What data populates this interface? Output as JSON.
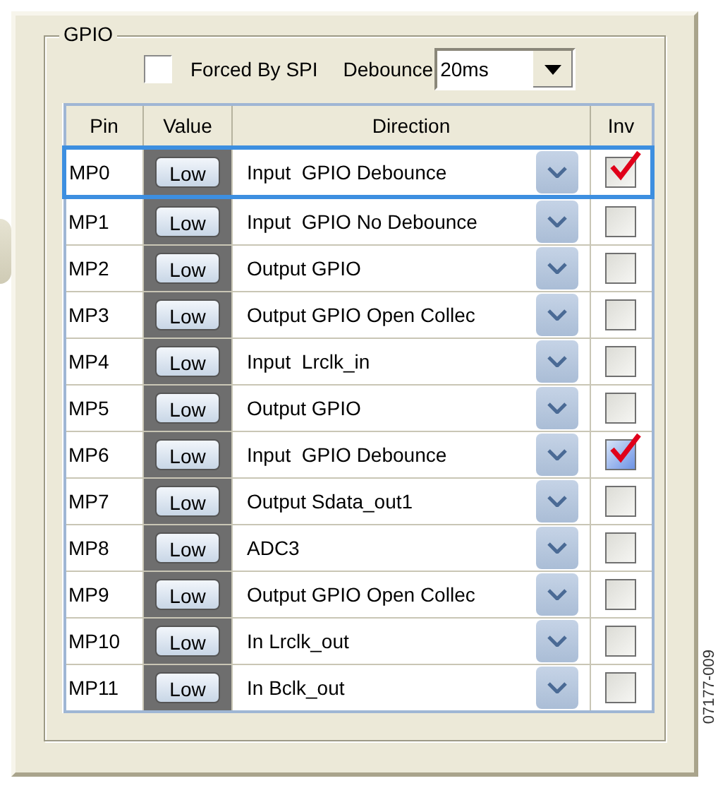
{
  "group": {
    "title": "GPIO"
  },
  "forced_by_spi": {
    "label": "Forced By SPI",
    "checked": false
  },
  "debounce": {
    "label": "Debounce",
    "value": "20ms"
  },
  "table": {
    "columns": [
      "Pin",
      "Value",
      "Direction",
      "Inv"
    ],
    "rows": [
      {
        "pin": "MP0",
        "value": "Low",
        "direction": "Input  GPIO Debounce",
        "inv": true,
        "inv_hover": false,
        "selected": true
      },
      {
        "pin": "MP1",
        "value": "Low",
        "direction": "Input  GPIO No Debounce",
        "inv": false,
        "inv_hover": false,
        "selected": false
      },
      {
        "pin": "MP2",
        "value": "Low",
        "direction": "Output GPIO",
        "inv": false,
        "inv_hover": false,
        "selected": false
      },
      {
        "pin": "MP3",
        "value": "Low",
        "direction": "Output GPIO Open Collec",
        "inv": false,
        "inv_hover": false,
        "selected": false
      },
      {
        "pin": "MP4",
        "value": "Low",
        "direction": "Input  Lrclk_in",
        "inv": false,
        "inv_hover": false,
        "selected": false
      },
      {
        "pin": "MP5",
        "value": "Low",
        "direction": "Output GPIO",
        "inv": false,
        "inv_hover": false,
        "selected": false
      },
      {
        "pin": "MP6",
        "value": "Low",
        "direction": "Input  GPIO Debounce",
        "inv": true,
        "inv_hover": true,
        "selected": false
      },
      {
        "pin": "MP7",
        "value": "Low",
        "direction": "Output Sdata_out1",
        "inv": false,
        "inv_hover": false,
        "selected": false
      },
      {
        "pin": "MP8",
        "value": "Low",
        "direction": "ADC3",
        "inv": false,
        "inv_hover": false,
        "selected": false
      },
      {
        "pin": "MP9",
        "value": "Low",
        "direction": "Output GPIO Open Collec",
        "inv": false,
        "inv_hover": false,
        "selected": false
      },
      {
        "pin": "MP10",
        "value": "Low",
        "direction": "In Lrclk_out",
        "inv": false,
        "inv_hover": false,
        "selected": false
      },
      {
        "pin": "MP11",
        "value": "Low",
        "direction": "In Bclk_out",
        "inv": false,
        "inv_hover": false,
        "selected": false
      }
    ]
  },
  "figure_id": "07177-009"
}
